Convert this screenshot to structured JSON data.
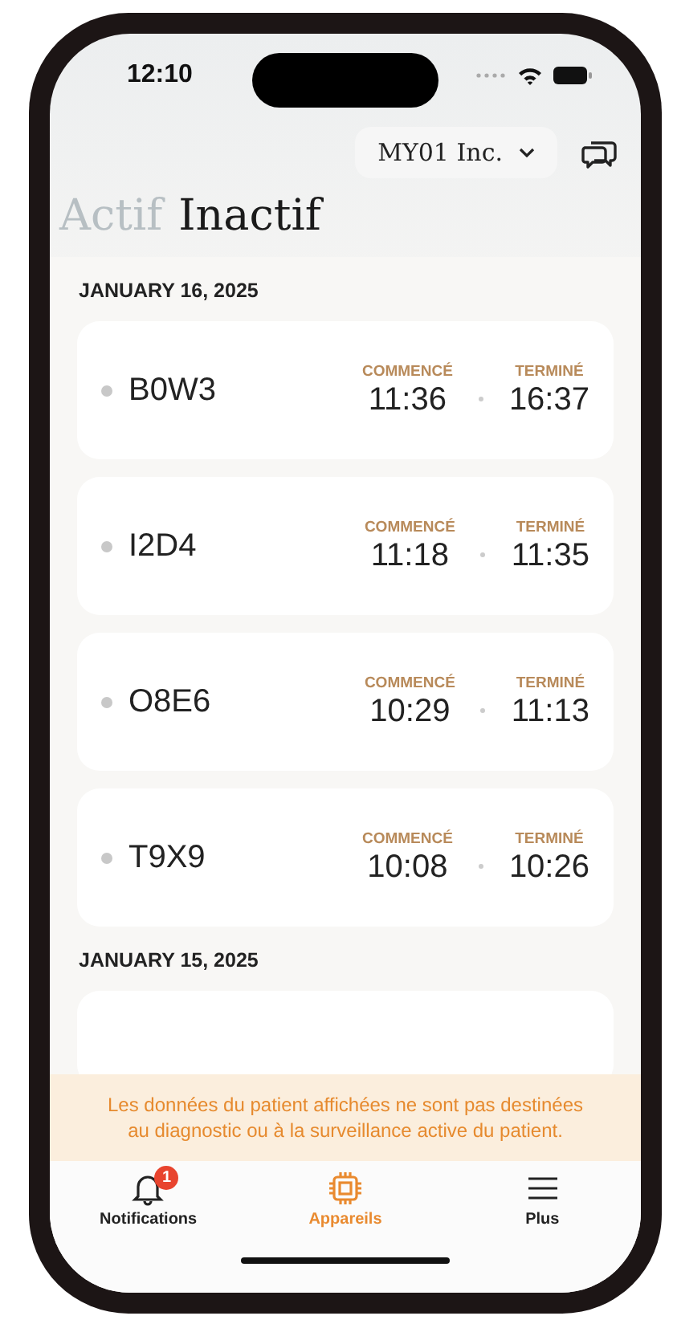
{
  "status_bar": {
    "time": "12:10"
  },
  "org_selector": {
    "label": "MY01 Inc."
  },
  "tabs": [
    {
      "label": "Actif",
      "selected": false
    },
    {
      "label": "Inactif",
      "selected": true
    }
  ],
  "groups": [
    {
      "date": "JANUARY 16, 2025",
      "sessions": [
        {
          "device": "B0W3",
          "started_label": "COMMENCÉ",
          "started": "11:36",
          "ended_label": "TERMINÉ",
          "ended": "16:37"
        },
        {
          "device": "I2D4",
          "started_label": "COMMENCÉ",
          "started": "11:18",
          "ended_label": "TERMINÉ",
          "ended": "11:35"
        },
        {
          "device": "O8E6",
          "started_label": "COMMENCÉ",
          "started": "10:29",
          "ended_label": "TERMINÉ",
          "ended": "11:13"
        },
        {
          "device": "T9X9",
          "started_label": "COMMENCÉ",
          "started": "10:08",
          "ended_label": "TERMINÉ",
          "ended": "10:26"
        }
      ]
    },
    {
      "date": "JANUARY 15, 2025",
      "truncated": true
    }
  ],
  "disclaimer": "Les données du patient affichées ne sont pas destinées au diagnostic ou à la surveillance active du patient.",
  "nav": [
    {
      "kind": "bell",
      "label": "Notifications",
      "badge": "1",
      "selected": false
    },
    {
      "kind": "chip",
      "label": "Appareils",
      "selected": true
    },
    {
      "kind": "menu",
      "label": "Plus",
      "selected": false
    }
  ]
}
